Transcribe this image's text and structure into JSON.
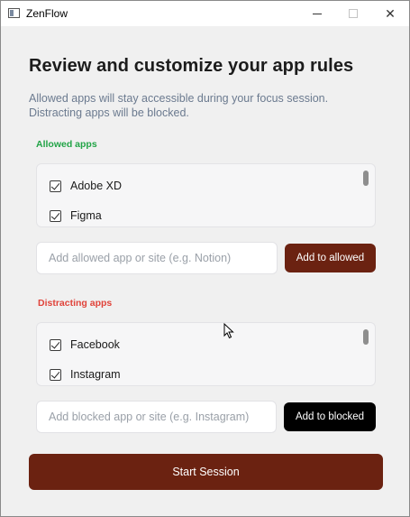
{
  "window": {
    "title": "ZenFlow",
    "minimize": "minimize",
    "maximize": "maximize",
    "close": "✕"
  },
  "header": {
    "title": "Review and customize your app rules",
    "description": "Allowed apps will stay accessible during your focus session. Distracting apps will be blocked."
  },
  "allowed": {
    "label": "Allowed apps",
    "items": [
      {
        "name": "Adobe XD",
        "checked": true
      },
      {
        "name": "Figma",
        "checked": true
      }
    ],
    "input_placeholder": "Add allowed app or site (e.g. Notion)",
    "add_label": "Add to allowed"
  },
  "distracting": {
    "label": "Distracting apps",
    "items": [
      {
        "name": "Facebook",
        "checked": true
      },
      {
        "name": "Instagram",
        "checked": true
      }
    ],
    "input_placeholder": "Add blocked app or site (e.g. Instagram)",
    "add_label": "Add to blocked"
  },
  "start_label": "Start Session",
  "colors": {
    "allowed_label": "#22a447",
    "distracting_label": "#e0433a",
    "primary_button": "#6b2211",
    "blocked_button": "#000000"
  }
}
